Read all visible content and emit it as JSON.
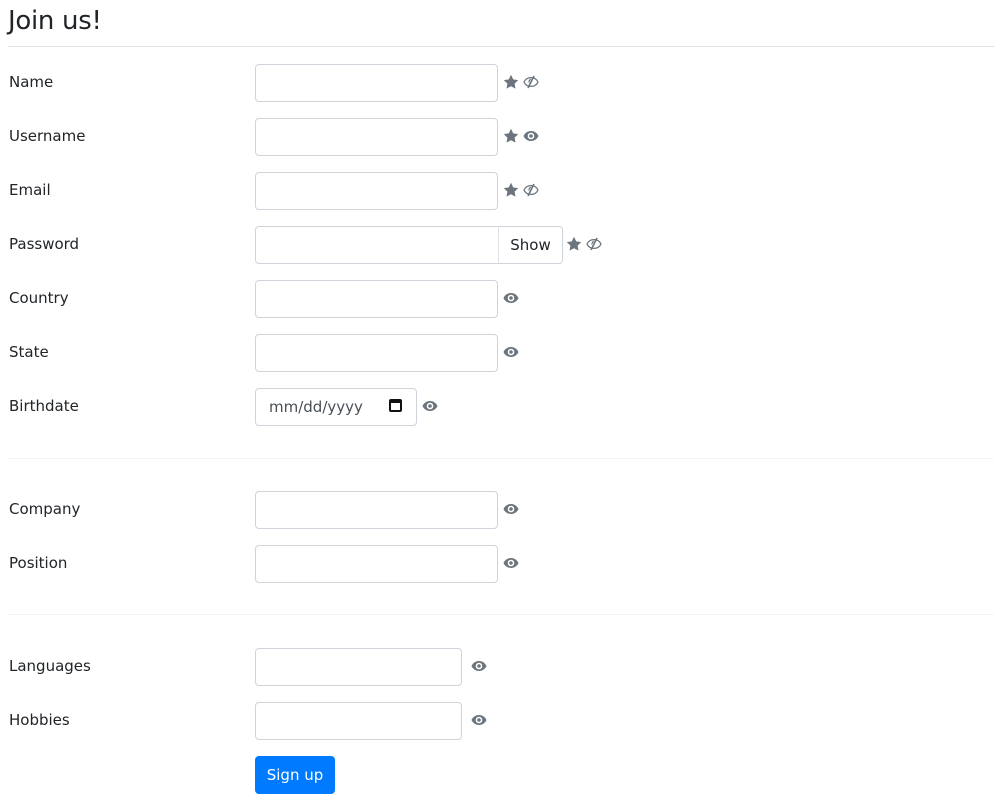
{
  "page": {
    "title": "Join us!"
  },
  "form": {
    "fields": [
      {
        "label": "Name",
        "value": "",
        "required": true,
        "visibility": "hidden"
      },
      {
        "label": "Username",
        "value": "",
        "required": true,
        "visibility": "visible"
      },
      {
        "label": "Email",
        "value": "",
        "required": true,
        "visibility": "hidden"
      },
      {
        "label": "Password",
        "value": "",
        "required": true,
        "visibility": "hidden",
        "toggle_label": "Show"
      },
      {
        "label": "Country",
        "value": "",
        "required": false,
        "visibility": "visible"
      },
      {
        "label": "State",
        "value": "",
        "required": false,
        "visibility": "visible"
      },
      {
        "label": "Birthdate",
        "value": "",
        "placeholder": "mm/dd/yyyy",
        "required": false,
        "visibility": "visible"
      },
      {
        "label": "Company",
        "value": "",
        "required": false,
        "visibility": "visible"
      },
      {
        "label": "Position",
        "value": "",
        "required": false,
        "visibility": "visible"
      },
      {
        "label": "Languages",
        "value": "",
        "required": false,
        "visibility": "visible"
      },
      {
        "label": "Hobbies",
        "value": "",
        "required": false,
        "visibility": "visible"
      }
    ],
    "submit_label": "Sign up"
  },
  "icons": {
    "required": "star-icon",
    "visible": "eye-icon",
    "hidden": "eye-slash-icon",
    "date": "calendar-icon"
  },
  "colors": {
    "primary": "#007bff",
    "icon": "#6c757d",
    "text": "#212529",
    "border": "#ced4da"
  }
}
